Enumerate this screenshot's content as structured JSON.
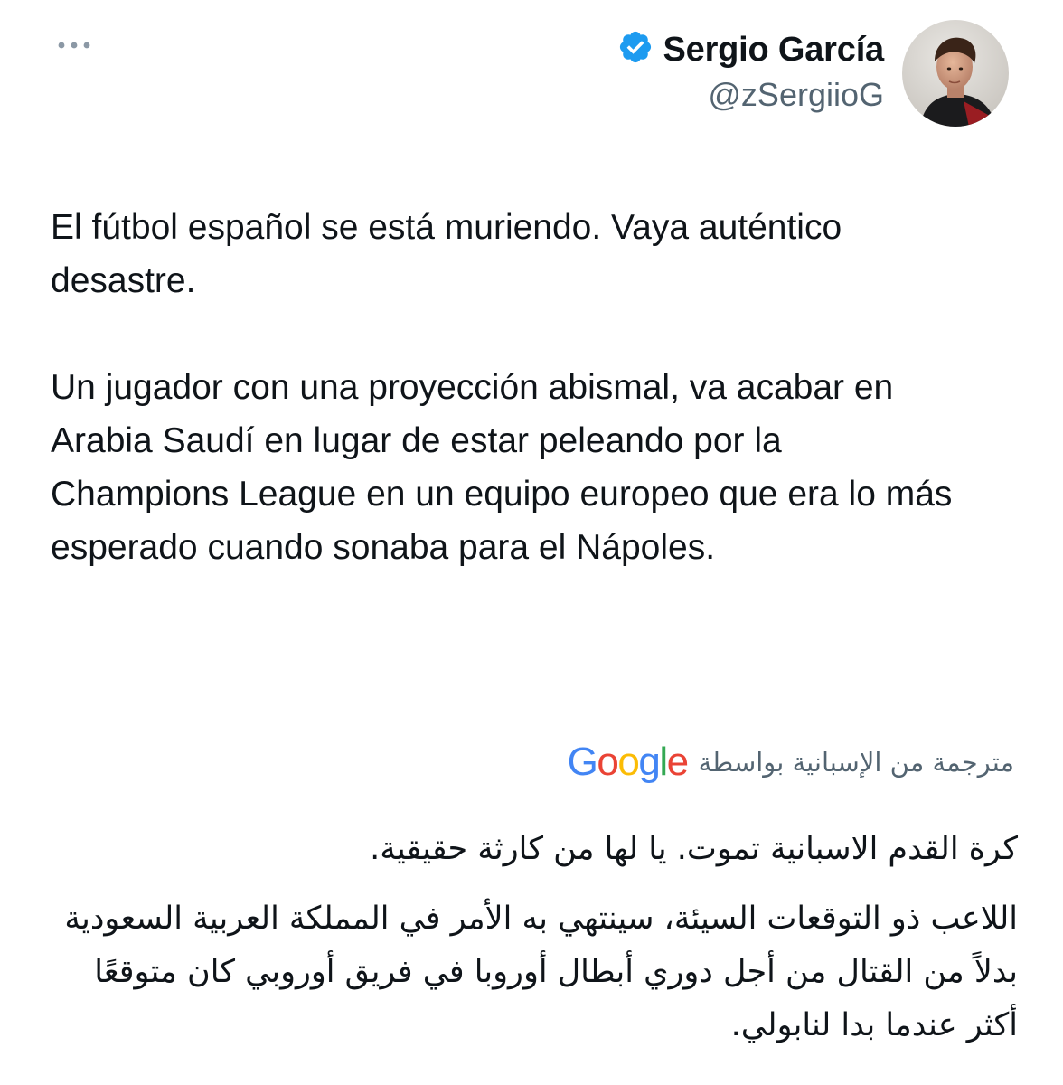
{
  "header": {
    "more_icon": "more-horizontal-icon",
    "display_name": "Sergio García",
    "verified_icon": "verified-badge-icon",
    "verified_color": "#1d9bf0",
    "handle": "@zSergiioG",
    "avatar_icon": "profile-photo"
  },
  "tweet": {
    "paragraphs": [
      "El fútbol español se está muriendo. Vaya auténtico desastre.",
      "Un jugador con una proyección abismal, va acabar en Arabia Saudí en lugar de estar peleando por la Champions League en un equipo europeo que era lo más esperado cuando sonaba para el Nápoles."
    ]
  },
  "translation": {
    "label": "مترجمة من الإسبانية بواسطة",
    "provider": "Google",
    "provider_colors": [
      "#4285F4",
      "#EA4335",
      "#FBBC05",
      "#4285F4",
      "#34A853",
      "#EA4335"
    ],
    "paragraphs": [
      "كرة القدم الاسبانية تموت. يا لها من كارثة حقيقية.",
      "اللاعب ذو التوقعات السيئة، سينتهي به الأمر في المملكة العربية السعودية بدلاً من القتال من أجل دوري أبطال أوروبا في فريق أوروبي كان متوقعًا أكثر عندما بدا لنابولي."
    ]
  }
}
